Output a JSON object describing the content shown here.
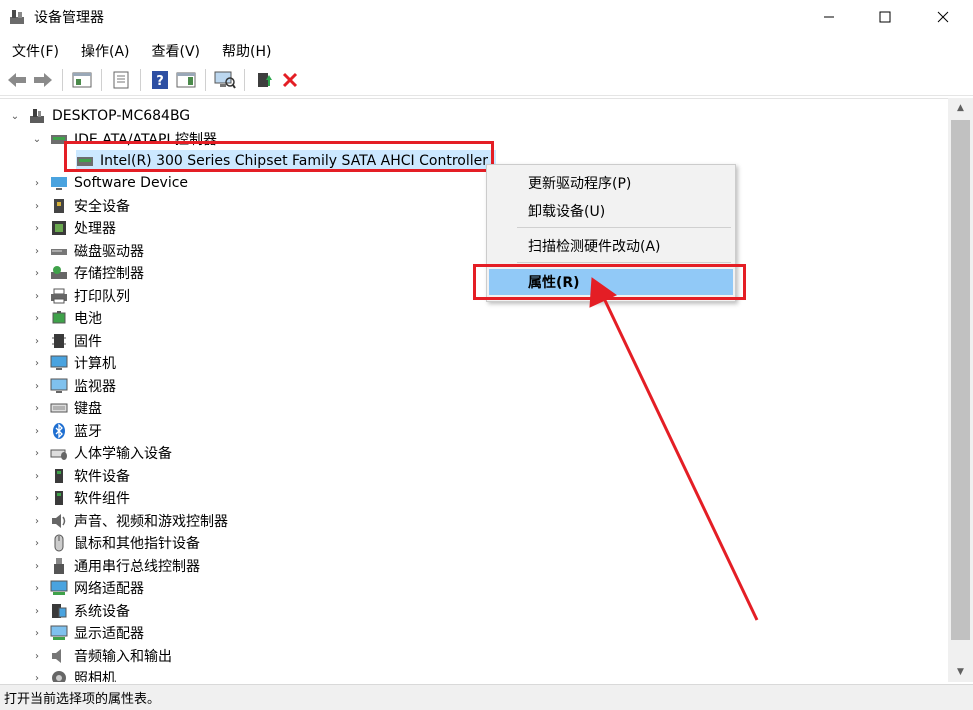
{
  "window": {
    "title": "设备管理器"
  },
  "menu": [
    "文件(F)",
    "操作(A)",
    "查看(V)",
    "帮助(H)"
  ],
  "tree": {
    "root": "DESKTOP-MC684BG",
    "ide_category": "IDE ATA/ATAPI 控制器",
    "selected_device": "Intel(R) 300 Series Chipset Family SATA AHCI Controller",
    "categories": [
      "Software Device",
      "安全设备",
      "处理器",
      "磁盘驱动器",
      "存储控制器",
      "打印队列",
      "电池",
      "固件",
      "计算机",
      "监视器",
      "键盘",
      "蓝牙",
      "人体学输入设备",
      "软件设备",
      "软件组件",
      "声音、视频和游戏控制器",
      "鼠标和其他指针设备",
      "通用串行总线控制器",
      "网络适配器",
      "系统设备",
      "显示适配器",
      "音频输入和输出",
      "照相机"
    ]
  },
  "context_menu": {
    "update_driver": "更新驱动程序(P)",
    "uninstall": "卸载设备(U)",
    "scan": "扫描检测硬件改动(A)",
    "properties": "属性(R)"
  },
  "status": "打开当前选择项的属性表。",
  "colors": {
    "highlight": "#e41e25",
    "selection": "#cce8ff",
    "menu_active": "#91c9f7"
  }
}
